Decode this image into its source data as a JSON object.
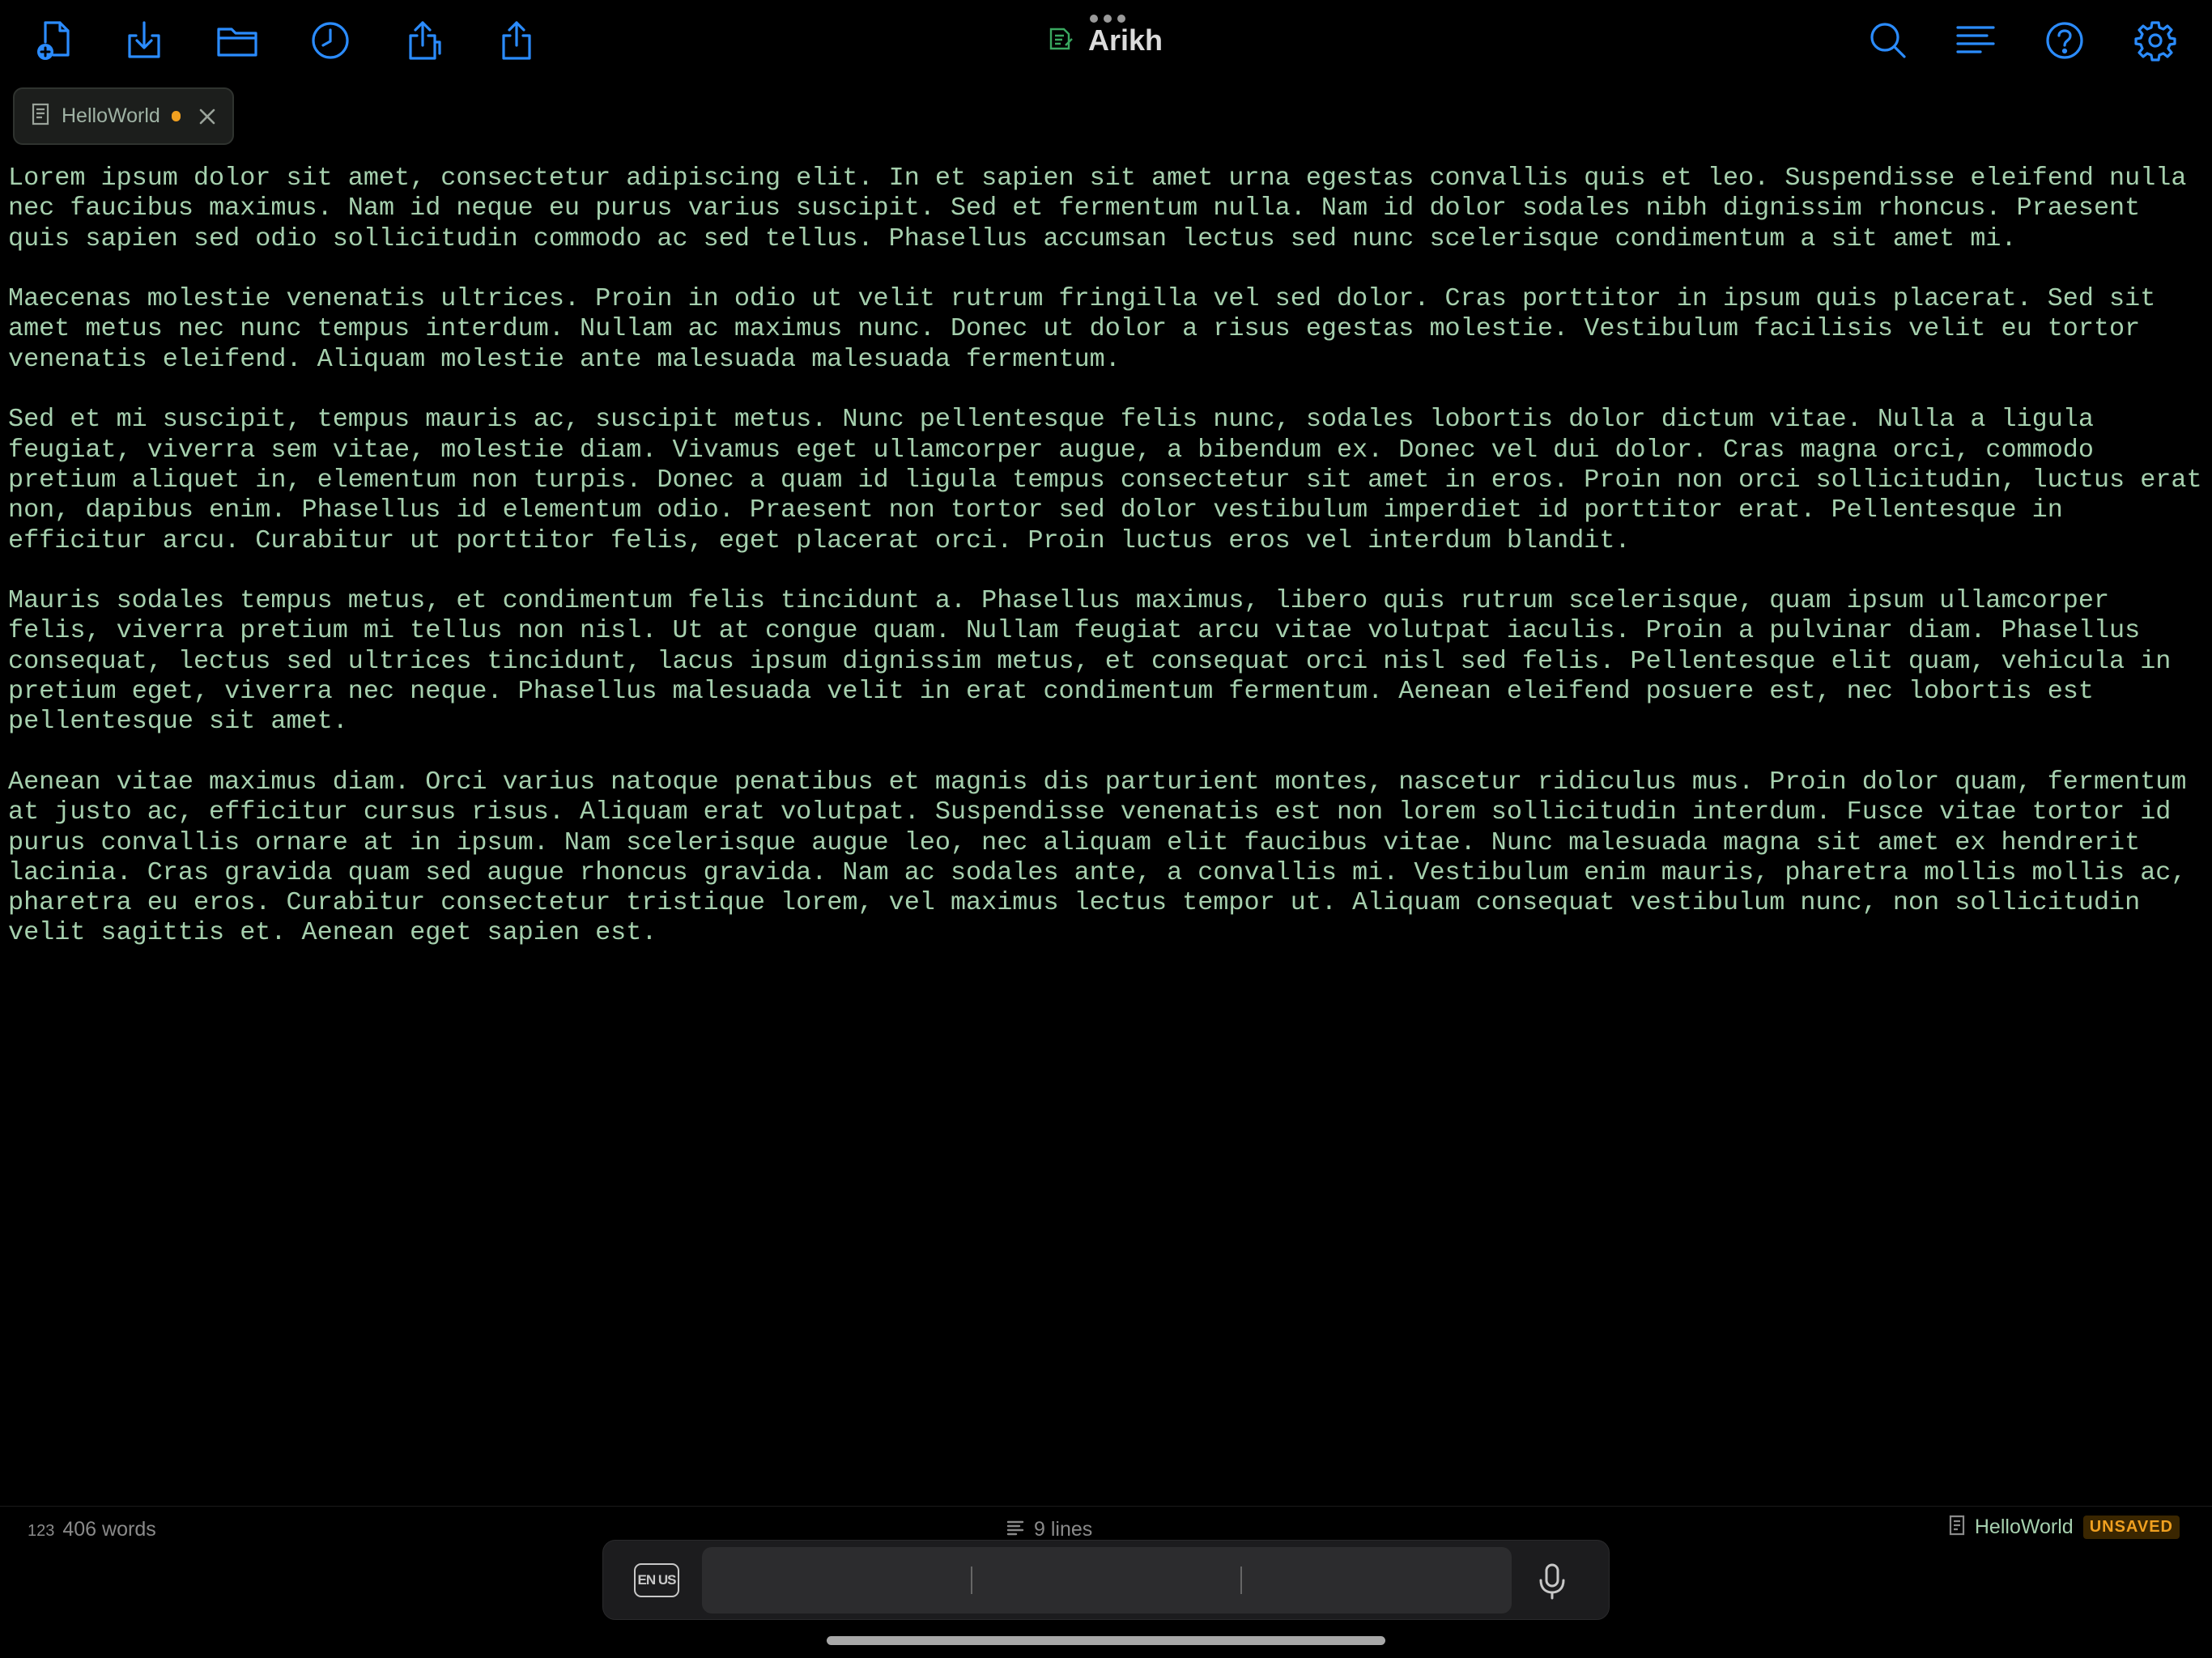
{
  "app": {
    "name": "Arikh"
  },
  "tab": {
    "label": "HelloWorld",
    "unsaved_dot_color": "#f0a020"
  },
  "toolbar": {
    "left_icons": [
      "new-file-icon",
      "download-icon",
      "folder-icon",
      "recent-clock-icon",
      "share-copy-icon",
      "share-icon"
    ],
    "right_icons": [
      "search-icon",
      "outline-list-icon",
      "help-icon",
      "settings-gear-icon"
    ],
    "accent_color": "#2b8cff"
  },
  "editor": {
    "text_color": "#a6d0ae",
    "paragraphs": [
      "Lorem ipsum dolor sit amet, consectetur adipiscing elit. In et sapien sit amet urna egestas convallis quis et leo. Suspendisse eleifend nulla nec faucibus maximus. Nam id neque eu purus varius suscipit. Sed et fermentum nulla. Nam id dolor sodales nibh dignissim rhoncus. Praesent quis sapien sed odio sollicitudin commodo ac sed tellus. Phasellus accumsan lectus sed nunc scelerisque condimentum a sit amet mi.",
      "Maecenas molestie venenatis ultrices. Proin in odio ut velit rutrum fringilla vel sed dolor. Cras porttitor in ipsum quis placerat. Sed sit amet metus nec nunc tempus interdum. Nullam ac maximus nunc. Donec ut dolor a risus egestas molestie. Vestibulum facilisis velit eu tortor venenatis eleifend. Aliquam molestie ante malesuada malesuada fermentum.",
      "Sed et mi suscipit, tempus mauris ac, suscipit metus. Nunc pellentesque felis nunc, sodales lobortis dolor dictum vitae. Nulla a ligula feugiat, viverra sem vitae, molestie diam. Vivamus eget ullamcorper augue, a bibendum ex. Donec vel dui dolor. Cras magna orci, commodo pretium aliquet in, elementum non turpis. Donec a quam id ligula tempus consectetur sit amet in eros. Proin non orci sollicitudin, luctus erat non, dapibus enim. Phasellus id elementum odio. Praesent non tortor sed dolor vestibulum imperdiet id porttitor erat. Pellentesque in efficitur arcu. Curabitur ut porttitor felis, eget placerat orci. Proin luctus eros vel interdum blandit.",
      "Mauris sodales tempus metus, et condimentum felis tincidunt a. Phasellus maximus, libero quis rutrum scelerisque, quam ipsum ullamcorper felis, viverra pretium mi tellus non nisl. Ut at congue quam. Nullam feugiat arcu vitae volutpat iaculis. Proin a pulvinar diam. Phasellus consequat, lectus sed ultrices tincidunt, lacus ipsum dignissim metus, et consequat orci nisl sed felis. Pellentesque elit quam, vehicula in pretium eget, viverra nec neque. Phasellus malesuada velit in erat condimentum fermentum. Aenean eleifend posuere est, nec lobortis est pellentesque sit amet.",
      "Aenean vitae maximus diam. Orci varius natoque penatibus et magnis dis parturient montes, nascetur ridiculus mus. Proin dolor quam, fermentum at justo ac, efficitur cursus risus. Aliquam erat volutpat. Suspendisse venenatis est non lorem sollicitudin interdum. Fusce vitae tortor id purus convallis ornare at in ipsum. Nam scelerisque augue leo, nec aliquam elit faucibus vitae. Nunc malesuada magna sit amet ex hendrerit lacinia. Cras gravida quam sed augue rhoncus gravida. Nam ac sodales ante, a convallis mi. Vestibulum enim mauris, pharetra mollis mollis ac, pharetra eu eros. Curabitur consectetur tristique lorem, vel maximus lectus tempor ut. Aliquam consequat vestibulum nunc, non sollicitudin velit sagittis et. Aenean eget sapien est."
    ]
  },
  "status": {
    "word_icon_text": "123",
    "word_count": "406 words",
    "line_count": "9 lines",
    "doc_name": "HelloWorld",
    "save_state": "UNSAVED",
    "save_state_color": "#f0a020"
  },
  "keyboard_bar": {
    "language": "EN US",
    "icons": [
      "language-switch-icon",
      "microphone-icon"
    ]
  }
}
